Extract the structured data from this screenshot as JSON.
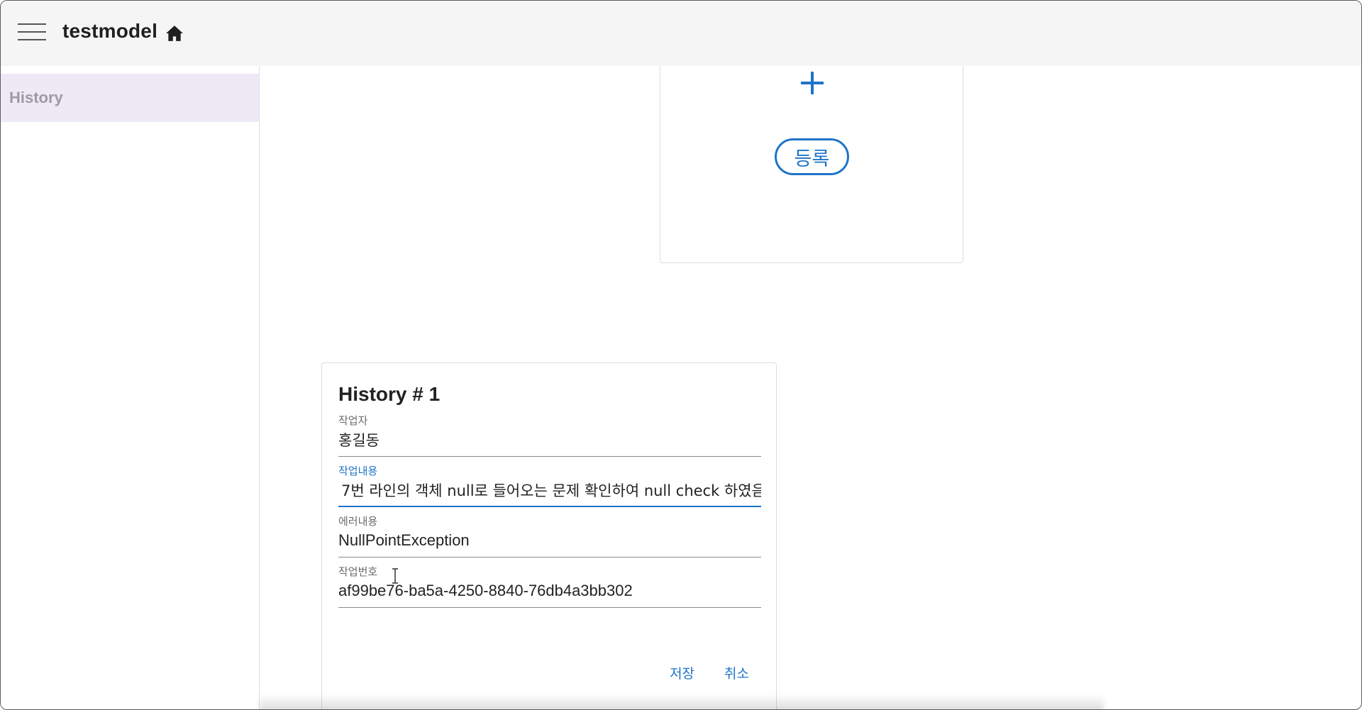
{
  "app": {
    "title": "testmodel",
    "menu_icon": "hamburger-menu-icon",
    "home_icon": "home-icon"
  },
  "sidebar": {
    "items": [
      {
        "label": "History",
        "selected": true
      }
    ]
  },
  "add_card": {
    "plus_icon": "plus-icon",
    "register_label": "등록"
  },
  "history_card": {
    "title": "History # 1",
    "fields": {
      "worker": {
        "label": "작업자",
        "value": "홍길동"
      },
      "work_content": {
        "label": "작업내용",
        "value": "7번 라인의 객체 null로 들어오는 문제 확인하여 null check 하였음"
      },
      "error_content": {
        "label": "에러내용",
        "value": "NullPointException"
      },
      "work_number": {
        "label": "작업번호",
        "value": "af99be76-ba5a-4250-8840-76db4a3bb302"
      }
    },
    "save_label": "저장",
    "cancel_label": "취소"
  },
  "colors": {
    "primary": "#1e74c9",
    "appbar_bg": "#f5f5f5",
    "sidebar_selected_bg": "#efe9f6"
  }
}
